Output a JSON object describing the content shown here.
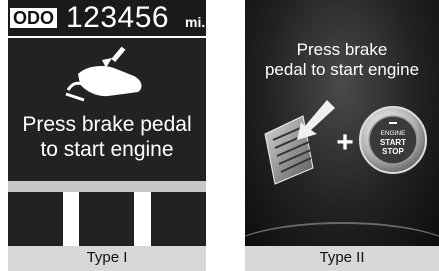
{
  "panel_type1": {
    "odometer": {
      "badge": "ODO",
      "value": "123456",
      "unit": "mi."
    },
    "message_line1": "Press brake pedal",
    "message_line2": "to start engine",
    "caption": "Type I",
    "icon": "foot-on-pedal-icon"
  },
  "panel_type2": {
    "message_line1": "Press brake",
    "message_line2": "pedal to start engine",
    "plus_sign": "+",
    "button_line1": "ENGINE",
    "button_line2": "START",
    "button_line3": "STOP",
    "caption": "Type II",
    "icons": [
      "brake-pedal-icon",
      "engine-start-stop-button-icon"
    ]
  },
  "colors": {
    "display_bg": "#222222",
    "text": "#ffffff",
    "band_gray": "#c8c8c8",
    "caption_bg": "#d8d8d8"
  }
}
